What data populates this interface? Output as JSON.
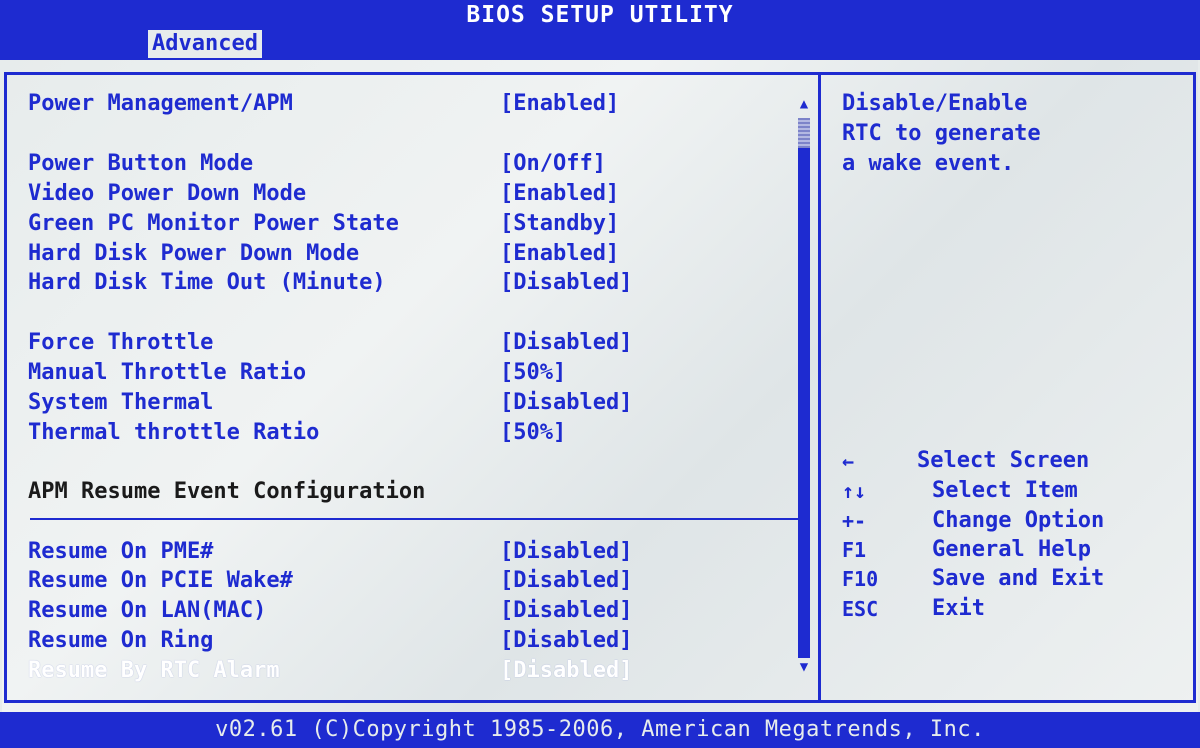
{
  "header": {
    "title": "BIOS SETUP UTILITY",
    "active_tab": "Advanced"
  },
  "settings": [
    {
      "label": "Power Management/APM",
      "value": "[Enabled]"
    },
    {
      "label": "Power Button Mode",
      "value": "[On/Off]"
    },
    {
      "label": "Video Power Down Mode",
      "value": "[Enabled]"
    },
    {
      "label": "Green PC Monitor Power State",
      "value": "[Standby]"
    },
    {
      "label": "Hard Disk Power Down Mode",
      "value": "[Enabled]"
    },
    {
      "label": "Hard Disk Time Out (Minute)",
      "value": "[Disabled]"
    },
    {
      "label": "Force Throttle",
      "value": "[Disabled]"
    },
    {
      "label": "Manual Throttle Ratio",
      "value": "[50%]"
    },
    {
      "label": "System Thermal",
      "value": "[Disabled]"
    },
    {
      "label": "Thermal throttle Ratio",
      "value": "[50%]"
    }
  ],
  "section_heading": "APM Resume Event Configuration",
  "resume_settings": [
    {
      "label": "Resume On PME#",
      "value": "[Disabled]"
    },
    {
      "label": "Resume On PCIE Wake#",
      "value": "[Disabled]"
    },
    {
      "label": "Resume On LAN(MAC)",
      "value": "[Disabled]"
    },
    {
      "label": "Resume On Ring",
      "value": "[Disabled]"
    },
    {
      "label": "Resume By RTC Alarm",
      "value": "[Disabled]",
      "selected": true
    }
  ],
  "help_text": [
    "Disable/Enable",
    "RTC to generate",
    "a wake event."
  ],
  "key_help": [
    {
      "key": "←",
      "desc": "Select Screen"
    },
    {
      "key": "↑↓",
      "desc": "Select Item"
    },
    {
      "key": "+-",
      "desc": "Change Option"
    },
    {
      "key": "F1",
      "desc": "General Help"
    },
    {
      "key": "F10",
      "desc": "Save and Exit"
    },
    {
      "key": "ESC",
      "desc": "Exit"
    }
  ],
  "footer": "v02.61 (C)Copyright 1985-2006, American Megatrends, Inc.",
  "colors": {
    "bios_blue": "#1e2bd0",
    "background": "#e7ecec",
    "highlight": "#ffffff"
  },
  "icons": {
    "scroll_up": "up-triangle-icon",
    "scroll_down": "down-triangle-icon"
  }
}
